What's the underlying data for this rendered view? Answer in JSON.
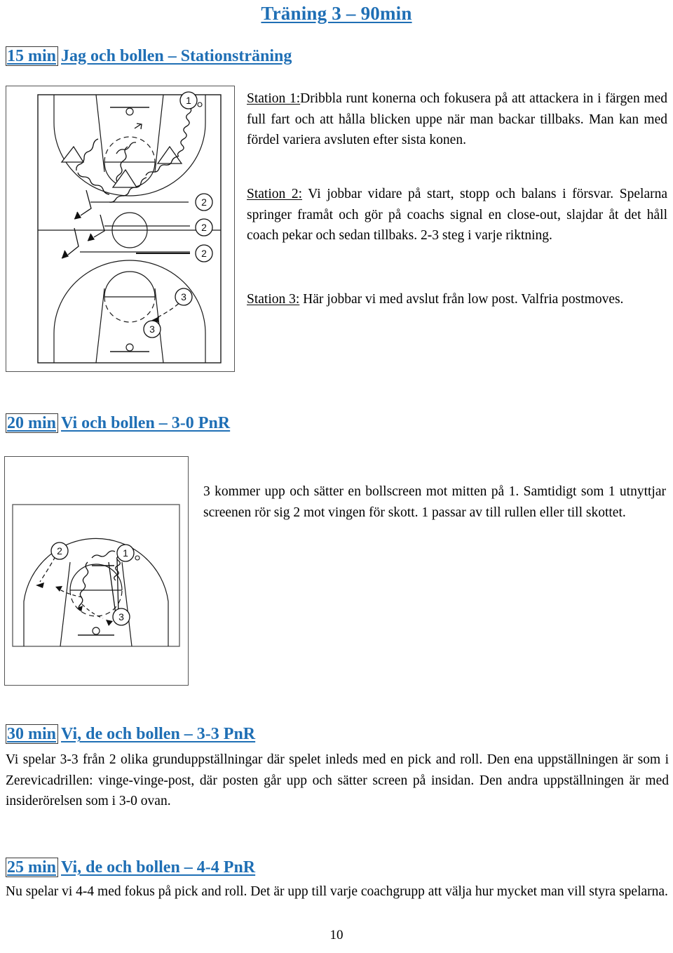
{
  "document": {
    "title": "Träning 3 – 90min",
    "page_number": "10"
  },
  "sections": [
    {
      "id": "station-training",
      "duration": "15 min",
      "title": "Jag och bollen – Stationsträning",
      "paragraphs": [
        {
          "id": "station-1",
          "label": "Station 1:",
          "text": "Dribbla runt konerna och fokusera på att attackera in i färgen med full fart och att hålla blicken uppe när man backar tillbaks. Man kan med fördel variera avsluten efter sista konen."
        },
        {
          "id": "station-2",
          "label": "Station 2:",
          "text": " Vi jobbar vidare på start, stopp och balans i försvar. Spelarna springer framåt och gör på coachs signal en close-out, slajdar åt det håll coach pekar och sedan tillbaks. 2-3 steg i varje riktning."
        },
        {
          "id": "station-3",
          "label": "Station 3:",
          "text": " Här jobbar vi med avslut från low post. Valfria postmoves."
        }
      ],
      "diagram": {
        "name": "fullcourt-stations-diagram",
        "player_markers": [
          "1",
          "2",
          "2",
          "2",
          "3",
          "3"
        ]
      }
    },
    {
      "id": "pnr-3-0",
      "duration": "20 min",
      "title": "Vi och bollen – 3-0 PnR",
      "paragraphs": [
        {
          "id": "pnr-3-0-text",
          "label": "",
          "text": "3 kommer upp och sätter en bollscreen mot mitten på 1. Samtidigt som 1 utnyttjar screenen rör sig 2 mot vingen för skott. 1 passar av till rullen eller till skottet."
        }
      ],
      "diagram": {
        "name": "halfcourt-pnr-diagram",
        "player_markers": [
          "1",
          "2",
          "3"
        ]
      }
    },
    {
      "id": "pnr-3-3",
      "duration": "30 min",
      "title": "Vi, de och bollen – 3-3 PnR",
      "paragraphs": [
        {
          "id": "pnr-3-3-text",
          "label": "",
          "text": "Vi spelar 3-3 från 2 olika grunduppställningar där spelet inleds med en pick and roll. Den ena uppställningen är som i Zerevicadrillen: vinge-vinge-post, där posten går upp och sätter screen på insidan. Den andra uppställningen är med insiderörelsen som i 3-0 ovan."
        }
      ]
    },
    {
      "id": "pnr-4-4",
      "duration": "25 min",
      "title": "Vi, de och bollen – 4-4 PnR",
      "paragraphs": [
        {
          "id": "pnr-4-4-text",
          "label": "",
          "text": "Nu spelar vi 4-4 med fokus på pick and roll. Det är upp till varje coachgrupp att välja hur mycket man vill styra spelarna."
        }
      ]
    }
  ],
  "colors": {
    "heading_blue": "#1F6FB5",
    "body_black": "#000000",
    "frame_gray": "#555555"
  }
}
